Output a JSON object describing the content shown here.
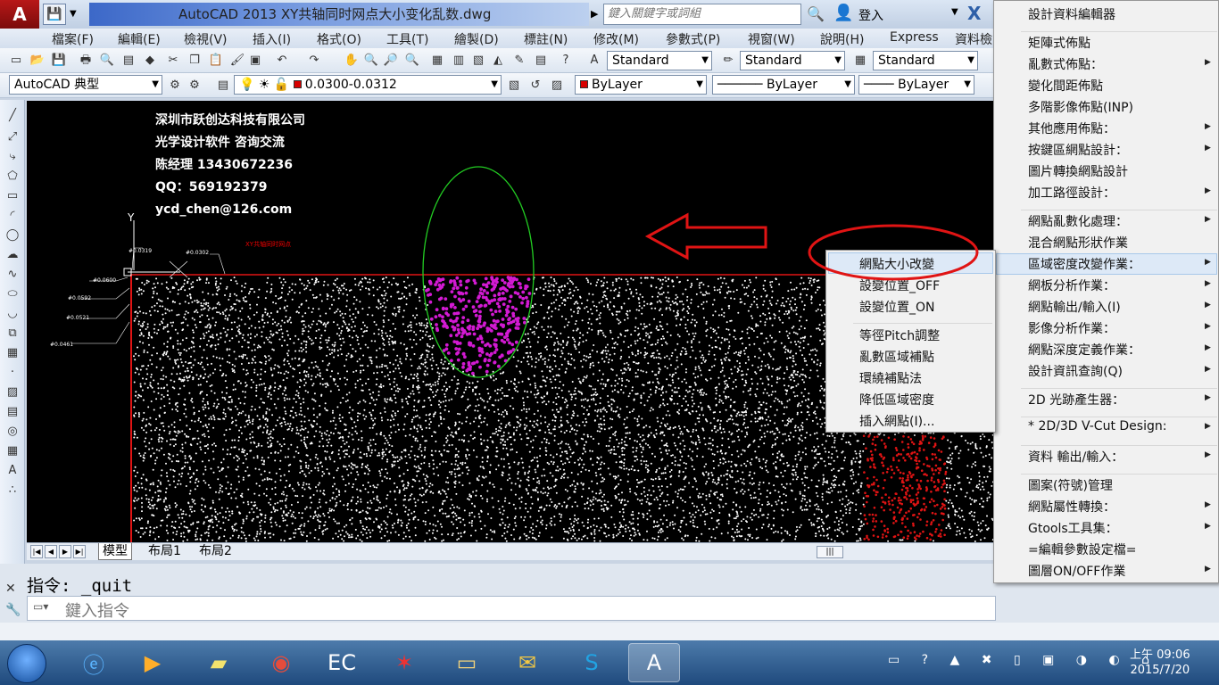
{
  "app": {
    "logo_letter": "A",
    "window_title": "AutoCAD 2013    XY共轴同时网点大小变化乱数.dwg",
    "search_placeholder": "鍵入關鍵字或詞組",
    "login_label": "登入",
    "x_logo": "X"
  },
  "menubar": [
    "檔案(F)",
    "編輯(E)",
    "檢視(V)",
    "插入(I)",
    "格式(O)",
    "工具(T)",
    "繪製(D)",
    "標註(N)",
    "修改(M)",
    "參數式(P)",
    "視窗(W)",
    "說明(H)",
    "Express",
    "資料檢"
  ],
  "toolbar1": {
    "text_style": "Standard",
    "dim_style": "Standard",
    "table_style": "Standard"
  },
  "toolbar2": {
    "workspace": "AutoCAD 典型",
    "layer": "0.0300-0.0312",
    "color": "ByLayer",
    "linetype": "ByLayer",
    "lineweight": "ByLayer",
    "layer_color": "#d80000"
  },
  "canvas": {
    "company_lines": [
      "深圳市跃创达科技有限公司",
      "光学设计软件  咨询交流",
      "陈经理   13430672236",
      "QQ：569192379",
      " ycd_chen@126.com"
    ],
    "y_axis_label": "Y",
    "red_label": "XY共轴同时网点",
    "dim_labels": [
      "#0.0319",
      "#0.0302",
      "#0.0600",
      "#0.0592",
      "#0.0521",
      "#0.0461"
    ],
    "dot_color_main": "#ffffff",
    "dot_color_magenta": "#d21ad2",
    "dot_color_red": "#e01414",
    "ellipse_color": "#22cc22",
    "arrow_color": "#e01414",
    "highlight_ring_color": "#e01414"
  },
  "tabs": {
    "model": "模型",
    "layout1": "布局1",
    "layout2": "布局2"
  },
  "command": {
    "history": "指令: _quit",
    "placeholder": "鍵入指令"
  },
  "side_menu": {
    "items": [
      {
        "label": "設計資料編輯器",
        "arrow": false
      },
      {
        "label": "矩陣式佈點",
        "arrow": false
      },
      {
        "label": "亂數式佈點：",
        "arrow": true
      },
      {
        "label": "變化間距佈點",
        "arrow": false
      },
      {
        "label": "多階影像佈點(INP)",
        "arrow": false
      },
      {
        "label": "其他應用佈點：",
        "arrow": true
      },
      {
        "label": "按鍵區網點設計：",
        "arrow": true
      },
      {
        "label": "圖片轉換網點設計",
        "arrow": false
      },
      {
        "label": "加工路徑設計：",
        "arrow": true
      },
      {
        "label": "網點亂數化處理：",
        "arrow": true
      },
      {
        "label": "混合網點形狀作業",
        "arrow": false
      },
      {
        "label": "區域密度改變作業：",
        "arrow": true
      },
      {
        "label": "網板分析作業：",
        "arrow": true
      },
      {
        "label": "網點輸出/輸入(I)",
        "arrow": true
      },
      {
        "label": "影像分析作業：",
        "arrow": true
      },
      {
        "label": "網點深度定義作業：",
        "arrow": true
      },
      {
        "label": "設計資訊查詢(Q)",
        "arrow": true
      },
      {
        "label": "2D 光跡產生器：",
        "arrow": true
      },
      {
        "label": "* 2D/3D V-Cut Design:",
        "arrow": true
      },
      {
        "label": "資料 輸出/輸入：",
        "arrow": true
      },
      {
        "label": "圖案(符號)管理",
        "arrow": false
      },
      {
        "label": "網點屬性轉換：",
        "arrow": true
      },
      {
        "label": "Gtools工具集：",
        "arrow": true
      },
      {
        "label": "=編輯參數設定檔=",
        "arrow": false
      },
      {
        "label": "圖層ON/OFF作業",
        "arrow": true
      }
    ]
  },
  "submenu": {
    "items": [
      "網點大小改變",
      "設變位置_OFF",
      "設變位置_ON",
      "等徑Pitch調整",
      "亂數區域補點",
      "環繞補點法",
      "降低區域密度",
      "插入網點(I)..."
    ]
  },
  "taskbar": {
    "time": "上午 09:06",
    "date": "2015/7/20"
  }
}
